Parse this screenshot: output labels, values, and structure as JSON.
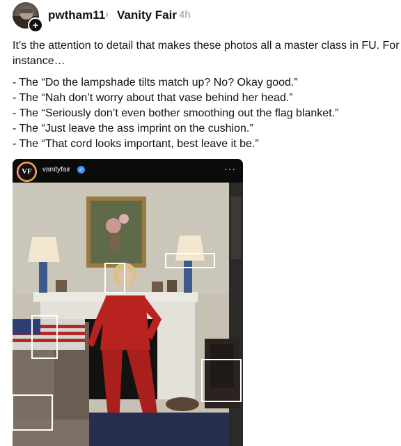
{
  "header": {
    "username": "pwtham11",
    "chevron_icon": "chevron-right-icon",
    "community": "Vanity Fair",
    "timestamp": "4h",
    "follow_glyph": "+"
  },
  "post": {
    "paragraph": "It’s the attention to detail that makes these photos all a master class in FU. For instance…",
    "items": [
      "- The “Do the lampshade tilts match up? No? Okay good.”",
      "- The “Nah don’t worry about that vase behind her head.”",
      "- The “Seriously don’t even bother smoothing out the flag blanket.”",
      "- The “Just leave the ass imprint on the cushion.”",
      "- The “That cord looks important, best leave it be.”"
    ]
  },
  "embed": {
    "logo_text": "VF",
    "account": "vanityfair",
    "more_label": "···",
    "verified_glyph": "✓"
  },
  "colors": {
    "card_bg": "#0c0c0c",
    "wall": "#c8c3b6",
    "suit": "#b8231f",
    "highlight_box": "#ffffff"
  }
}
